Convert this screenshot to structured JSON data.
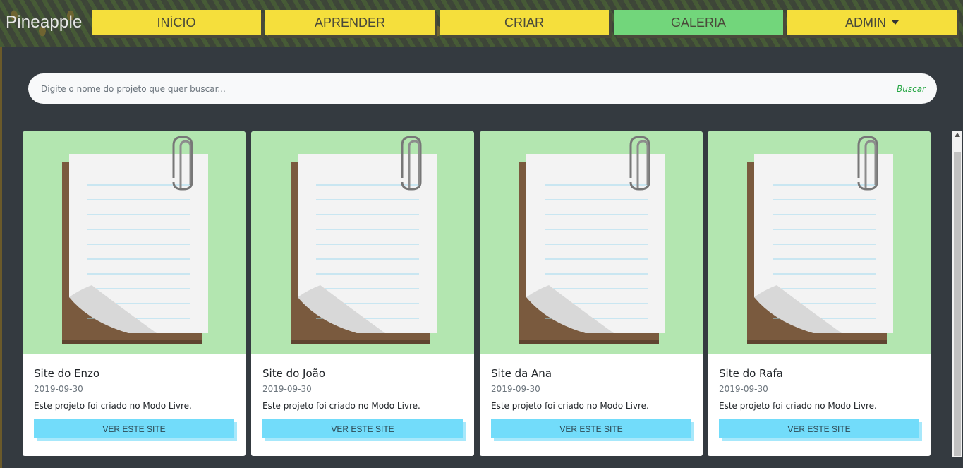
{
  "brand": "Pineapple",
  "nav": [
    {
      "label": "INÍCIO"
    },
    {
      "label": "APRENDER"
    },
    {
      "label": "CRIAR"
    },
    {
      "label": "GALERIA"
    },
    {
      "label": "ADMIN"
    }
  ],
  "search": {
    "placeholder": "Digite o nome do projeto que quer buscar...",
    "button": "Buscar"
  },
  "projects": [
    {
      "title": "Site do Enzo",
      "date": "2019-09-30",
      "description": "Este projeto foi criado no Modo Livre.",
      "button": "VER ESTE SITE"
    },
    {
      "title": "Site do João",
      "date": "2019-09-30",
      "description": "Este projeto foi criado no Modo Livre.",
      "button": "VER ESTE SITE"
    },
    {
      "title": "Site da Ana",
      "date": "2019-09-30",
      "description": "Este projeto foi criado no Modo Livre.",
      "button": "VER ESTE SITE"
    },
    {
      "title": "Site do Rafa",
      "date": "2019-09-30",
      "description": "Este projeto foi criado no Modo Livre.",
      "button": "VER ESTE SITE"
    }
  ],
  "colors": {
    "nav_button": "#f5df3c",
    "nav_active": "#72d67b",
    "card_image_bg": "#b3e6b0",
    "card_button": "#72dcfa",
    "page_bg": "#343a40"
  },
  "icons": {
    "card_image": "notepad-paperclip-icon",
    "dropdown": "caret-down-icon"
  }
}
